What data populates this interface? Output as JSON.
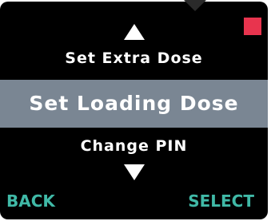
{
  "device": {
    "status_color": "#e8344e",
    "accent_color": "#40b9a7",
    "highlight_color": "#7a8693"
  },
  "menu": {
    "up_icon": "triangle-up",
    "down_icon": "triangle-down",
    "items": [
      {
        "label": "Set Extra Dose"
      },
      {
        "label": "Set Loading Dose"
      },
      {
        "label": "Change PIN"
      }
    ]
  },
  "softkeys": {
    "left_label": "BACK",
    "right_label": "SELECT"
  }
}
